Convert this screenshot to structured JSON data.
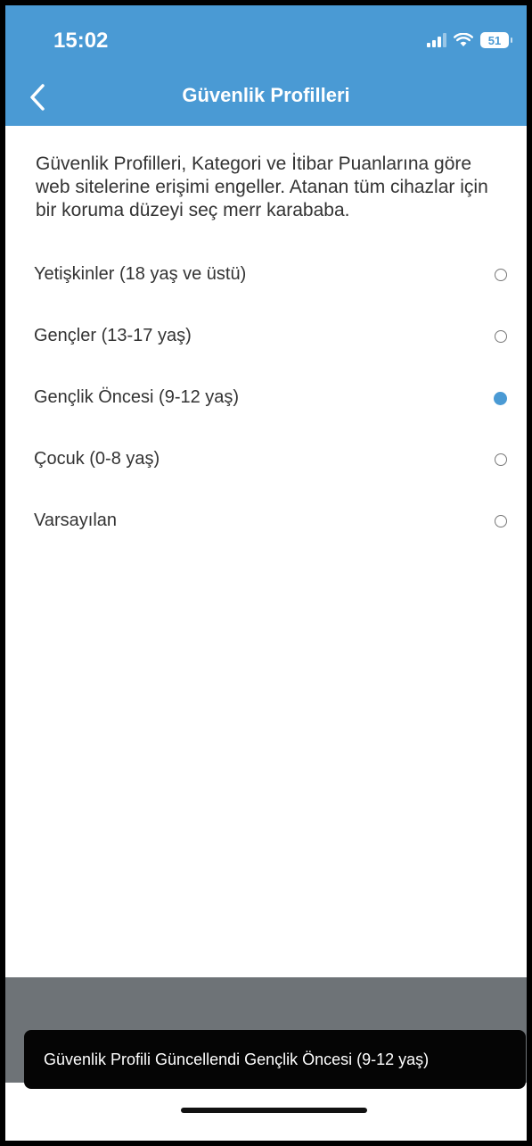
{
  "status_bar": {
    "time": "15:02",
    "battery": "51",
    "icons": [
      "signal-icon",
      "wifi-icon",
      "battery-icon"
    ]
  },
  "nav": {
    "title": "Güvenlik Profilleri",
    "back_icon": "chevron-left-icon"
  },
  "description": "Güvenlik Profilleri, Kategori ve İtibar Puanlarına göre web sitelerine erişimi engeller. Atanan tüm cihazlar için bir koruma düzeyi seç merr karababa.",
  "options": [
    {
      "label": "Yetişkinler (18 yaş ve üstü)",
      "selected": false
    },
    {
      "label": "Gençler (13-17 yaş)",
      "selected": false
    },
    {
      "label": "Gençlik Öncesi (9-12 yaş)",
      "selected": true
    },
    {
      "label": "Çocuk (0-8 yaş)",
      "selected": false
    },
    {
      "label": "Varsayılan",
      "selected": false
    }
  ],
  "toast": {
    "message": "Güvenlik Profili Güncellendi Gençlik Öncesi (9-12 yaş)"
  },
  "colors": {
    "accent": "#4a9ad4",
    "header_bg": "#4a9ad4",
    "toast_bg": "#050505",
    "bottom_bar_bg": "#6e7377"
  }
}
